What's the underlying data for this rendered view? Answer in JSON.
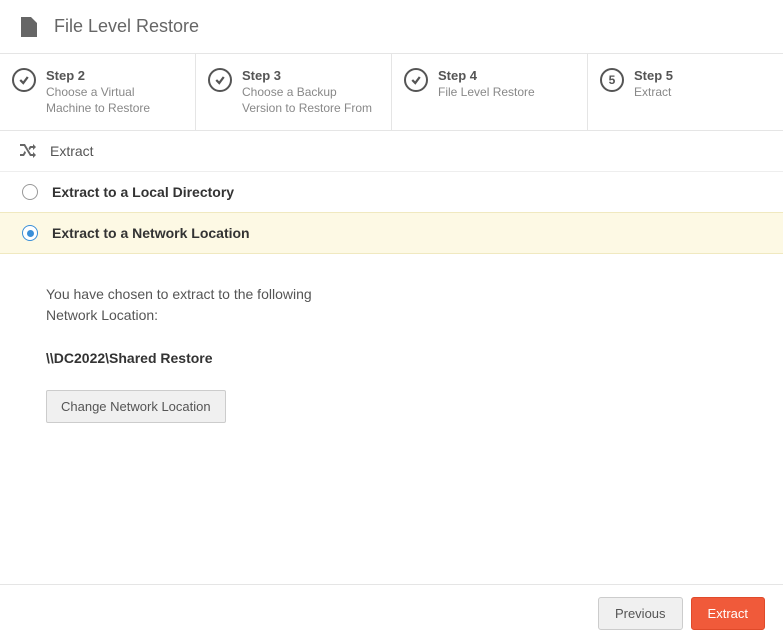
{
  "header": {
    "title": "File Level Restore"
  },
  "steps": [
    {
      "title": "Step 2",
      "desc": "Choose a Virtual Machine to Restore",
      "done": true
    },
    {
      "title": "Step 3",
      "desc": "Choose a Backup Version to Restore From",
      "done": true
    },
    {
      "title": "Step 4",
      "desc": "File Level Restore",
      "done": true
    },
    {
      "title": "Step 5",
      "desc": "Extract",
      "done": false,
      "number": "5"
    }
  ],
  "section": {
    "title": "Extract"
  },
  "options": {
    "local": {
      "label": "Extract to a Local Directory",
      "selected": false
    },
    "network": {
      "label": "Extract to a Network Location",
      "selected": true
    }
  },
  "content": {
    "intro_line1": "You have chosen to extract to the following",
    "intro_line2": "Network Location:",
    "path": "\\\\DC2022\\Shared Restore",
    "change_btn": "Change Network Location"
  },
  "footer": {
    "previous": "Previous",
    "extract": "Extract"
  }
}
